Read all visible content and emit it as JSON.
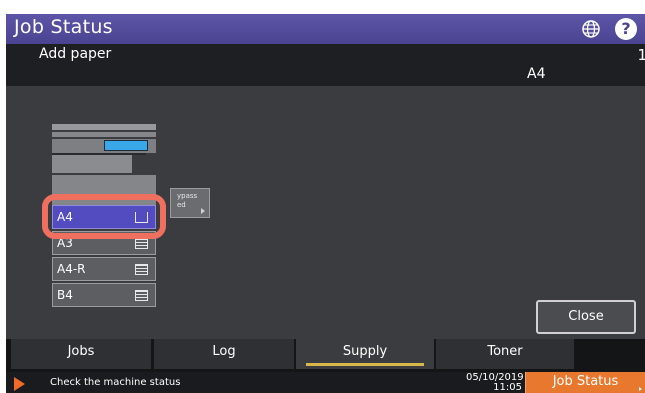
{
  "titlebar": {
    "title": "Job Status",
    "globe_icon": "globe-icon",
    "help_icon": "help-icon",
    "help_glyph": "?"
  },
  "message": {
    "text": "Add paper",
    "count": "1",
    "paper_size": "A4"
  },
  "bypass": {
    "label_line1": "ypass",
    "label_line2": "ed"
  },
  "trays": [
    {
      "label": "A4",
      "selected": true
    },
    {
      "label": "A3",
      "selected": false
    },
    {
      "label": "A4-R",
      "selected": false
    },
    {
      "label": "B4",
      "selected": false
    }
  ],
  "close_label": "Close",
  "tabs": [
    {
      "label": "Jobs",
      "active": false
    },
    {
      "label": "Log",
      "active": false
    },
    {
      "label": "Supply",
      "active": true
    },
    {
      "label": "Toner",
      "active": false
    }
  ],
  "status": {
    "text": "Check the machine status",
    "date": "05/10/2019",
    "time": "11:05",
    "job_status_label": "Job Status"
  },
  "colors": {
    "title_bar": "#4a4390",
    "highlight": "#f07060",
    "accent": "#e8782e",
    "selected_tray": "#524cc0"
  }
}
